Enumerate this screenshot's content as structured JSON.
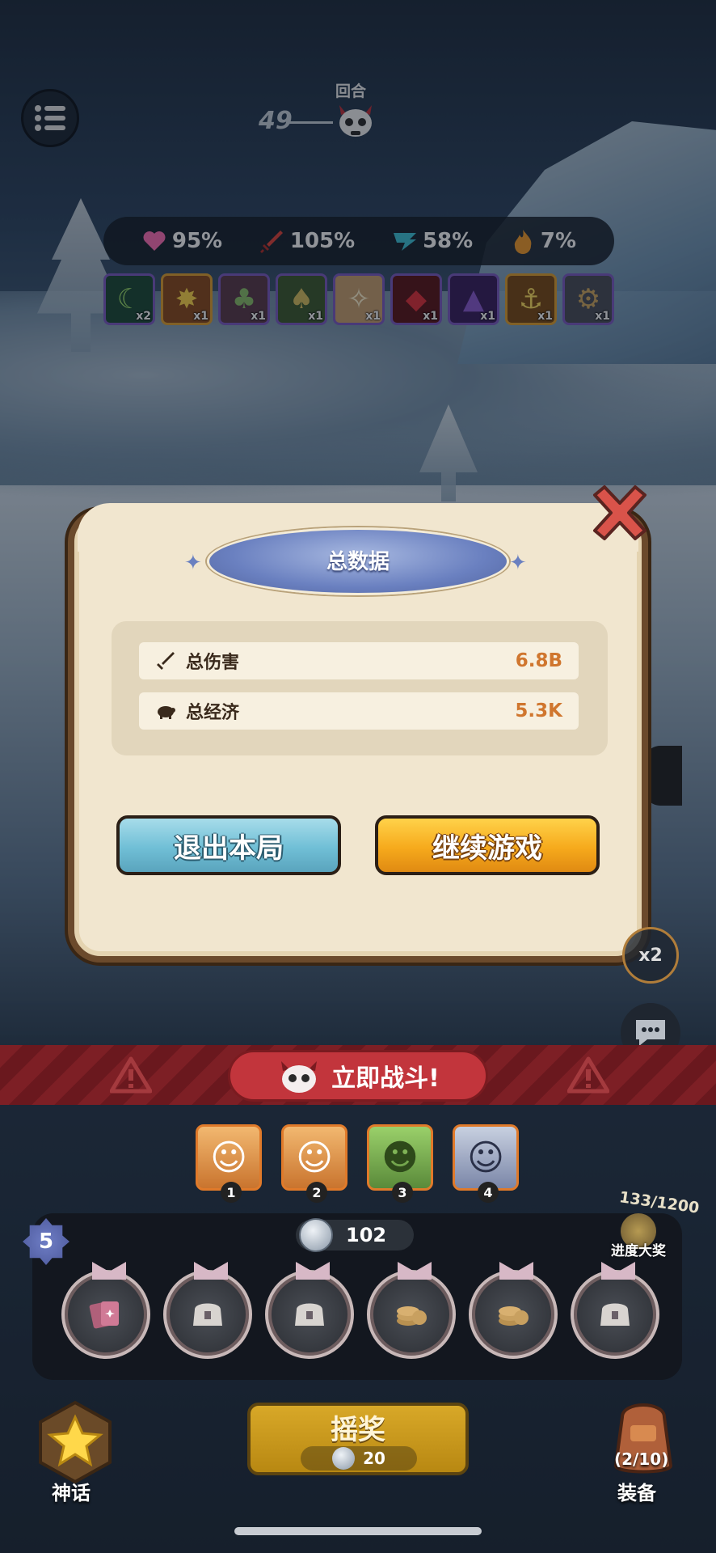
{
  "round": {
    "label": "回合",
    "number": "49"
  },
  "stats": [
    {
      "icon": "heart-icon",
      "value": "95%",
      "color": "#ff6fb6"
    },
    {
      "icon": "sword-icon",
      "value": "105%",
      "color": "#e0423a"
    },
    {
      "icon": "speed-icon",
      "value": "58%",
      "color": "#3ec4d8"
    },
    {
      "icon": "fire-icon",
      "value": "7%",
      "color": "#f29b2a"
    }
  ],
  "buffs": [
    {
      "icon": "moon-cross-icon",
      "count": "x2",
      "glyph": "☾"
    },
    {
      "icon": "sun-burst-icon",
      "count": "x1",
      "glyph": "✸"
    },
    {
      "icon": "tree-icon",
      "count": "x1",
      "glyph": "♣"
    },
    {
      "icon": "mushroom-icon",
      "count": "x1",
      "glyph": "♠"
    },
    {
      "icon": "scroll-icon",
      "count": "x1",
      "glyph": "✧"
    },
    {
      "icon": "demon-icon",
      "count": "x1",
      "glyph": "◆"
    },
    {
      "icon": "wolf-icon",
      "count": "x1",
      "glyph": "▲"
    },
    {
      "icon": "anchor-light-icon",
      "count": "x1",
      "glyph": "⚓"
    },
    {
      "icon": "gears-icon",
      "count": "x1",
      "glyph": "⚙"
    }
  ],
  "dialog": {
    "title": "总数据",
    "rows": [
      {
        "icon": "sword-icon",
        "label": "总伤害",
        "value": "6.8B"
      },
      {
        "icon": "piggy-bank-icon",
        "label": "总经济",
        "value": "5.3K"
      }
    ],
    "exit_label": "退出本局",
    "continue_label": "继续游戏"
  },
  "speed_label": "x2",
  "fight_label": "立即战斗!",
  "heroes": [
    {
      "num": "1",
      "glyph": "☺"
    },
    {
      "num": "2",
      "glyph": "☺"
    },
    {
      "num": "3",
      "glyph": "☻"
    },
    {
      "num": "4",
      "glyph": "☺"
    }
  ],
  "level": "5",
  "coins": "102",
  "progress": {
    "value": "133/1200",
    "label": "进度大奖"
  },
  "slots": [
    "card-icon",
    "chest-icon",
    "chest-icon",
    "coins-icon",
    "coins-icon",
    "chest-icon"
  ],
  "myth_label": "神话",
  "spin": {
    "label": "摇奖",
    "cost": "20"
  },
  "equip": {
    "count": "(2/10)",
    "label": "装备"
  }
}
